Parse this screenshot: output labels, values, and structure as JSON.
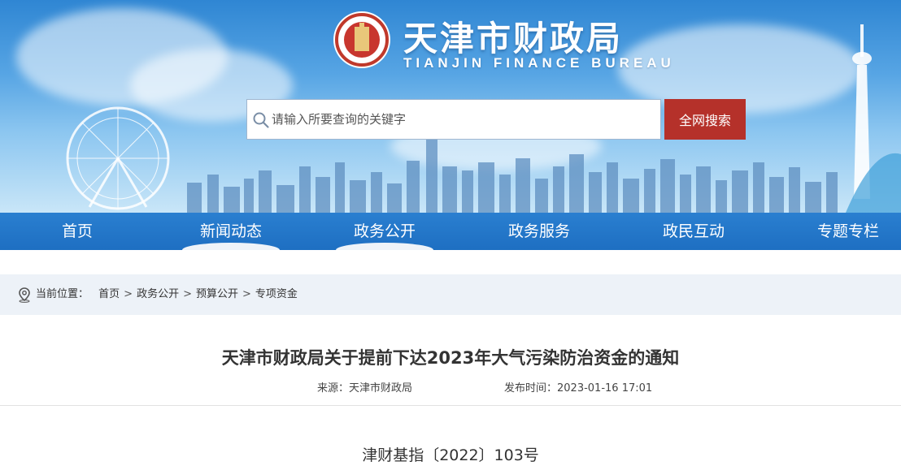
{
  "header": {
    "title": "天津市财政局",
    "subtitle": "TIANJIN FINANCE BUREAU"
  },
  "search": {
    "placeholder": "请输入所要查询的关键字",
    "value": "",
    "button_label": "全网搜索"
  },
  "nav": {
    "items": [
      {
        "label": "首页"
      },
      {
        "label": "新闻动态"
      },
      {
        "label": "政务公开"
      },
      {
        "label": "政务服务"
      },
      {
        "label": "政民互动"
      },
      {
        "label": "专题专栏"
      }
    ]
  },
  "breadcrumb": {
    "prefix": "当前位置：",
    "items": [
      {
        "label": "首页"
      },
      {
        "label": "政务公开"
      },
      {
        "label": "预算公开"
      },
      {
        "label": "专项资金"
      }
    ],
    "separator": ">"
  },
  "article": {
    "title": "天津市财政局关于提前下达2023年大气污染防治资金的通知",
    "source_label": "来源：",
    "source_value": "天津市财政局",
    "time_label": "发布时间：",
    "time_value": "2023-01-16 17:01",
    "doc_number": "津财基指〔2022〕103号"
  },
  "colors": {
    "nav_blue": "#1e6fc2",
    "search_button_red": "#b5312a",
    "breadcrumb_bg": "#edf2f8"
  },
  "icons": {
    "search": "search-icon",
    "location": "location-pin-icon",
    "emblem": "bureau-emblem-icon"
  }
}
